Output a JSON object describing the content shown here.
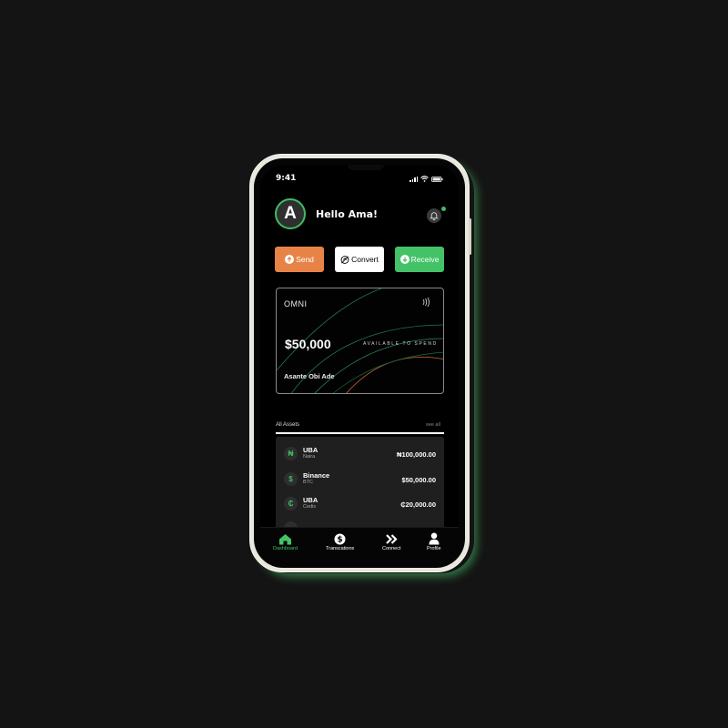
{
  "status_bar": {
    "time": "9:41"
  },
  "header": {
    "avatar_letter": "A",
    "greeting": "Hello Ama!"
  },
  "actions": {
    "send_label": "Send",
    "convert_label": "Convert",
    "receive_label": "Receive"
  },
  "card": {
    "brand": "OMNI",
    "balance": "$50,000",
    "available_label": "AVAILABLE TO SPEND",
    "holder": "Asante Obi Ade"
  },
  "assets": {
    "title": "All Assets",
    "see_all": "see all",
    "items": [
      {
        "symbol": "₦",
        "name": "UBA",
        "sub": "Naira",
        "amount": "₦100,000.00"
      },
      {
        "symbol": "$",
        "name": "Binance",
        "sub": "BTC",
        "amount": "$50,000.00"
      },
      {
        "symbol": "₵",
        "name": "UBA",
        "sub": "Cedis",
        "amount": "₵20,000.00"
      }
    ]
  },
  "nav": {
    "items": [
      {
        "label": "Dashboard",
        "icon": "home-icon",
        "active": true
      },
      {
        "label": "Transcations",
        "icon": "dollar-icon",
        "active": false
      },
      {
        "label": "Connect",
        "icon": "double-chevron-icon",
        "active": false
      },
      {
        "label": "Profile",
        "icon": "user-icon",
        "active": false
      }
    ]
  },
  "colors": {
    "accent_green": "#44c267",
    "send_orange": "#e88348",
    "background": "#141414"
  }
}
